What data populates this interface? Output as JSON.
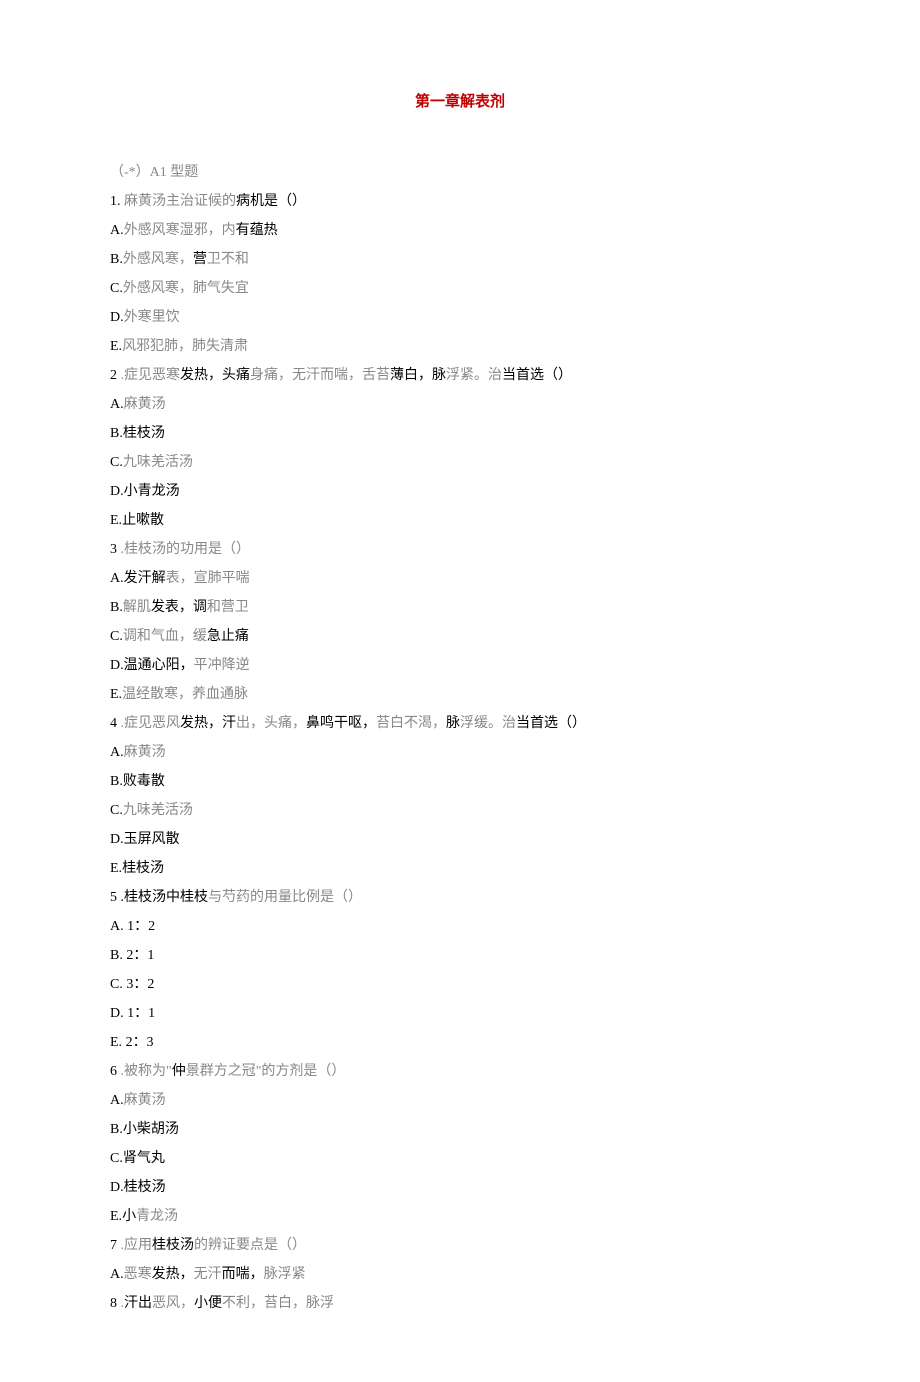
{
  "title": "第一章解表剂",
  "section_header": "（-*）A1 型题",
  "questions": [
    {
      "num": "1.",
      "stem_parts": [
        {
          "t": "麻黄汤主治证候的",
          "grey": true
        },
        {
          "t": "病机是（）",
          "grey": false
        }
      ],
      "options": [
        {
          "label": "A.",
          "parts": [
            {
              "t": "外感风寒湿邪，内",
              "grey": true
            },
            {
              "t": "有蕴热",
              "grey": false
            }
          ]
        },
        {
          "label": "B.",
          "parts": [
            {
              "t": "外感风寒，",
              "grey": true
            },
            {
              "t": "营",
              "grey": false
            },
            {
              "t": "卫不和",
              "grey": true
            }
          ]
        },
        {
          "label": "C.",
          "parts": [
            {
              "t": "外感风寒，肺气失宜",
              "grey": true
            }
          ]
        },
        {
          "label": "D.",
          "parts": [
            {
              "t": "外寒里饮",
              "grey": true
            }
          ]
        },
        {
          "label": "E.",
          "parts": [
            {
              "t": "风邪犯肺，肺失清肃",
              "grey": true
            }
          ]
        }
      ]
    },
    {
      "num": "2",
      "stem_parts": [
        {
          "t": " .症见恶寒",
          "grey": true
        },
        {
          "t": "发热，头痛",
          "grey": false
        },
        {
          "t": "身痛，无汗而喘，舌苔",
          "grey": true
        },
        {
          "t": "薄白，脉",
          "grey": false
        },
        {
          "t": "浮紧。治",
          "grey": true
        },
        {
          "t": "当首选（）",
          "grey": false
        }
      ],
      "options": [
        {
          "label": "A.",
          "parts": [
            {
              "t": "麻黄汤",
              "grey": true
            }
          ]
        },
        {
          "label": "B.",
          "parts": [
            {
              "t": "桂枝汤",
              "grey": false
            }
          ]
        },
        {
          "label": "C.",
          "parts": [
            {
              "t": "九味羌活汤",
              "grey": true
            }
          ]
        },
        {
          "label": "D.",
          "parts": [
            {
              "t": "小青龙汤",
              "grey": false
            }
          ]
        },
        {
          "label": "E.",
          "parts": [
            {
              "t": "止嗽散",
              "grey": false
            }
          ]
        }
      ]
    },
    {
      "num": "3",
      "stem_parts": [
        {
          "t": " .桂枝汤的功用是（）",
          "grey": true
        }
      ],
      "options": [
        {
          "label": "A.",
          "parts": [
            {
              "t": "发汗解",
              "grey": false
            },
            {
              "t": "表，宣肺平喘",
              "grey": true
            }
          ]
        },
        {
          "label": "B.",
          "parts": [
            {
              "t": "解肌",
              "grey": true
            },
            {
              "t": "发表，调",
              "grey": false
            },
            {
              "t": "和营卫",
              "grey": true
            }
          ]
        },
        {
          "label": "C.",
          "parts": [
            {
              "t": "调和气血，缓",
              "grey": true
            },
            {
              "t": "急止痛",
              "grey": false
            }
          ]
        },
        {
          "label": "D.",
          "parts": [
            {
              "t": "温通",
              "grey": false
            },
            {
              "t": "心阳，",
              "grey": false
            },
            {
              "t": "平冲降逆",
              "grey": true
            }
          ]
        },
        {
          "label": "E.",
          "parts": [
            {
              "t": "温经散寒，养血通脉",
              "grey": true
            }
          ]
        }
      ]
    },
    {
      "num": "4",
      "stem_parts": [
        {
          "t": " .症见恶风",
          "grey": true
        },
        {
          "t": "发热，汗",
          "grey": false
        },
        {
          "t": "出，头痛，",
          "grey": true
        },
        {
          "t": "鼻鸣干呕，",
          "grey": false
        },
        {
          "t": "苔白不渴，",
          "grey": true
        },
        {
          "t": "脉",
          "grey": false
        },
        {
          "t": "浮缓。治",
          "grey": true
        },
        {
          "t": "当首选（）",
          "grey": false
        }
      ],
      "options": [
        {
          "label": "A.",
          "parts": [
            {
              "t": "麻黄汤",
              "grey": true
            }
          ]
        },
        {
          "label": "B.",
          "parts": [
            {
              "t": "败毒散",
              "grey": false
            }
          ]
        },
        {
          "label": "C.",
          "parts": [
            {
              "t": "九味羌活汤",
              "grey": true
            }
          ]
        },
        {
          "label": "D.",
          "parts": [
            {
              "t": "玉屏风散",
              "grey": false
            }
          ]
        },
        {
          "label": "E.",
          "parts": [
            {
              "t": "桂枝汤",
              "grey": false
            }
          ]
        }
      ]
    },
    {
      "num": "5",
      "stem_parts": [
        {
          "t": " .桂枝汤中桂枝",
          "grey": false
        },
        {
          "t": "与芍药的用量比例是（）",
          "grey": true
        }
      ],
      "options": [
        {
          "label": "A.",
          "parts": [
            {
              "t": "  1：2",
              "grey": false
            }
          ]
        },
        {
          "label": "B.",
          "parts": [
            {
              "t": "  2：1",
              "grey": false
            }
          ]
        },
        {
          "label": "C.",
          "parts": [
            {
              "t": "  3：2",
              "grey": false
            }
          ]
        },
        {
          "label": "D.",
          "parts": [
            {
              "t": "  1：1",
              "grey": false
            }
          ]
        },
        {
          "label": "E.",
          "parts": [
            {
              "t": "  2：3",
              "grey": false
            }
          ]
        }
      ]
    },
    {
      "num": "6",
      "stem_parts": [
        {
          "t": " .被称为\"",
          "grey": true
        },
        {
          "t": "仲",
          "grey": false
        },
        {
          "t": "景群方之冠\"的方剂是（）",
          "grey": true
        }
      ],
      "options": [
        {
          "label": "A.",
          "parts": [
            {
              "t": "麻黄汤",
              "grey": true
            }
          ]
        },
        {
          "label": "B.",
          "parts": [
            {
              "t": "小柴胡汤",
              "grey": false
            }
          ]
        },
        {
          "label": "C.",
          "parts": [
            {
              "t": "肾气丸",
              "grey": false
            }
          ]
        },
        {
          "label": "D.",
          "parts": [
            {
              "t": "桂枝汤",
              "grey": false
            }
          ]
        },
        {
          "label": "E.",
          "parts": [
            {
              "t": "小",
              "grey": false
            },
            {
              "t": "青龙汤",
              "grey": true
            }
          ]
        }
      ]
    },
    {
      "num": "7",
      "stem_parts": [
        {
          "t": " .应用",
          "grey": true
        },
        {
          "t": "桂枝汤",
          "grey": false
        },
        {
          "t": "的辨证要点是（）",
          "grey": true
        }
      ],
      "options": [
        {
          "label": "A.",
          "parts": [
            {
              "t": "恶寒",
              "grey": true
            },
            {
              "t": "发热，",
              "grey": false
            },
            {
              "t": "无汗",
              "grey": true
            },
            {
              "t": "而喘，",
              "grey": false
            },
            {
              "t": "脉浮紧",
              "grey": true
            }
          ]
        }
      ]
    },
    {
      "num": "8",
      "stem_parts": [
        {
          "t": " .",
          "grey": true
        },
        {
          "t": "汗出",
          "grey": false
        },
        {
          "t": "恶风，",
          "grey": true
        },
        {
          "t": "小便",
          "grey": false
        },
        {
          "t": "不利，苔白，脉浮",
          "grey": true
        }
      ],
      "options": []
    }
  ]
}
